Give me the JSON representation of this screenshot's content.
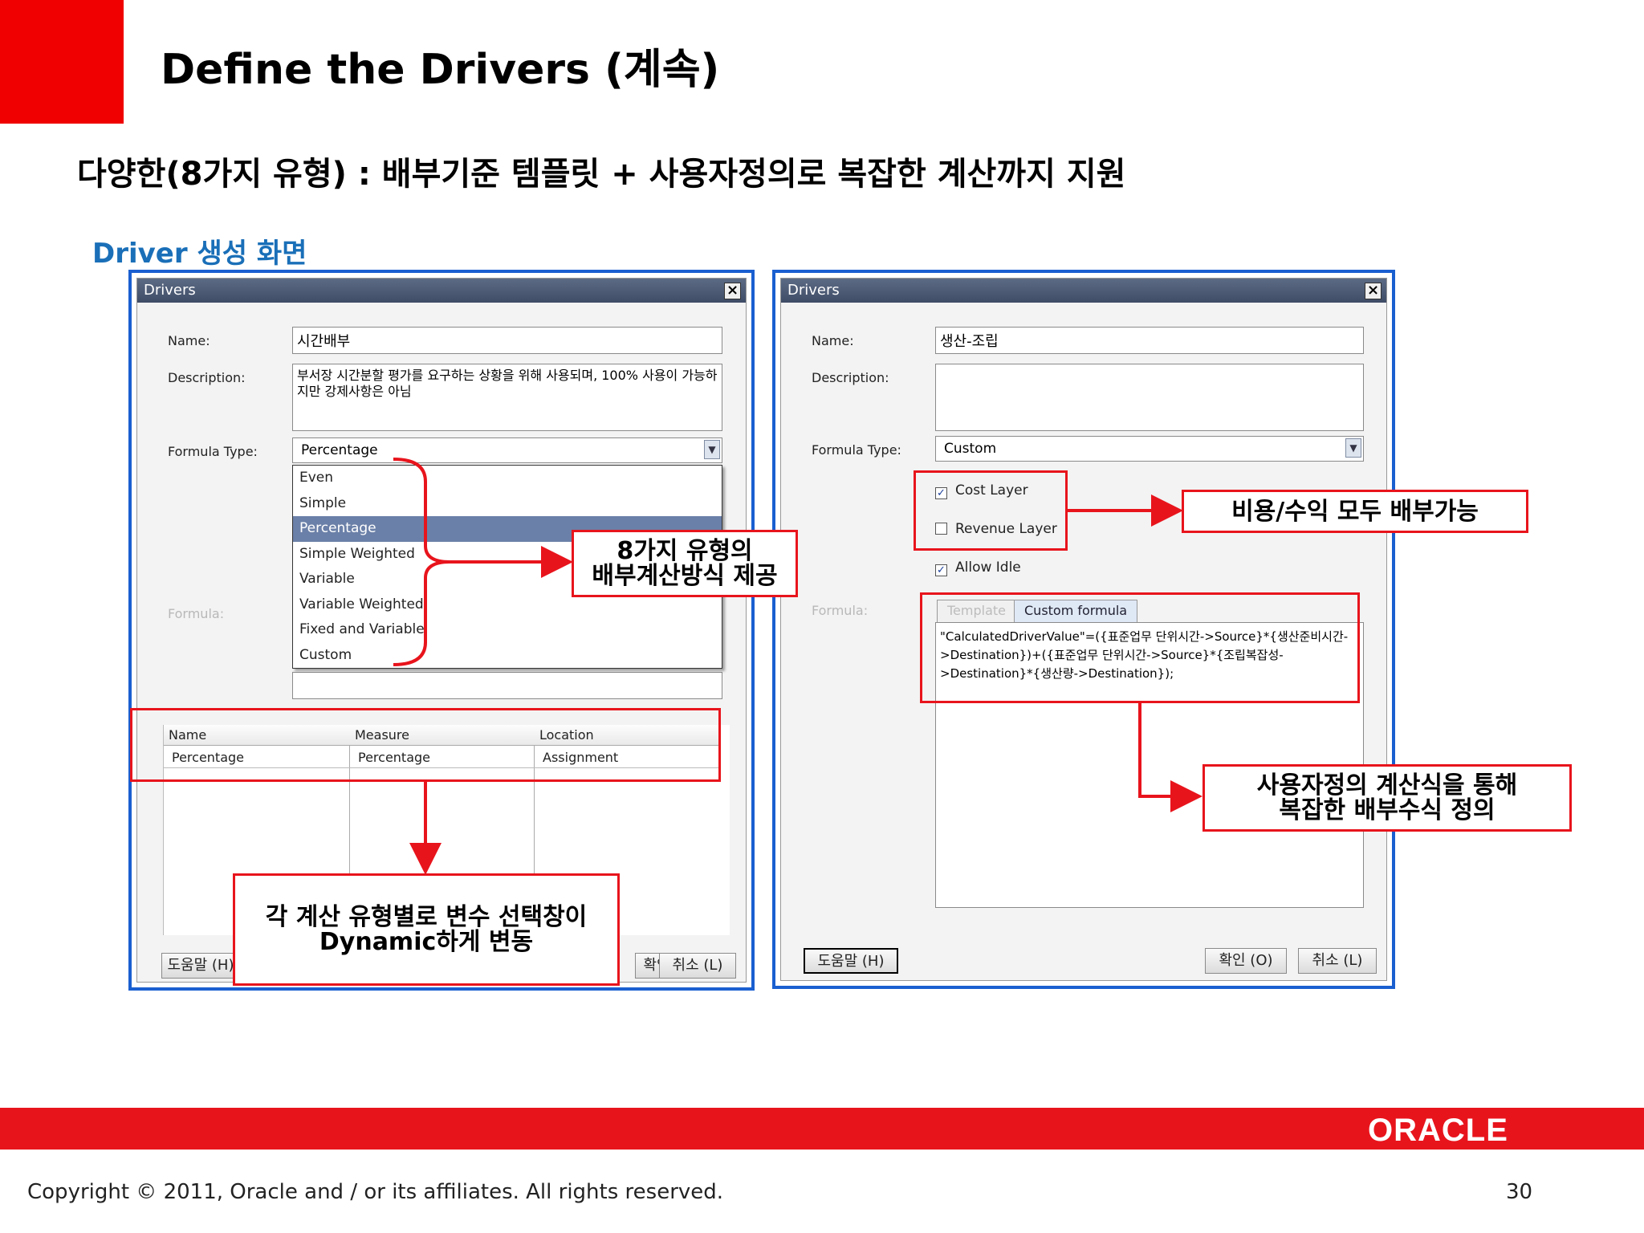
{
  "slide": {
    "title": "Define the Drivers (계속)",
    "subtitle": "다양한(8가지 유형) : 배부기준 템플릿  + 사용자정의로 복잡한 계산까지 지원",
    "section_label": "Driver 생성 화면",
    "accent_color": "#e8141c",
    "label_color": "#1a6fb8"
  },
  "left_dialog": {
    "title": "Drivers",
    "close_icon": "×",
    "name_label": "Name:",
    "name_value": "시간배부",
    "description_label": "Description:",
    "description_value": "부서장 시간분할 평가를 요구하는 상황을 위해 사용되며, 100% 사용이 가능하지만 강제사항은 아님",
    "formula_type_label": "Formula Type:",
    "formula_type_value": "Percentage",
    "formula_label": "Formula:",
    "dropdown_options": [
      "Even",
      "Simple",
      "Percentage",
      "Simple Weighted",
      "Variable",
      "Variable Weighted",
      "Fixed and Variable",
      "Custom"
    ],
    "dropdown_selected": "Percentage",
    "grid_headers": [
      "Name",
      "Measure",
      "Location"
    ],
    "grid_row": [
      "Percentage",
      "Percentage",
      "Assignment"
    ],
    "help_button": "도움말 (H)",
    "ok_button": "확인 (O)",
    "cancel_button": "취소 (L)"
  },
  "right_dialog": {
    "title": "Drivers",
    "close_icon": "×",
    "name_label": "Name:",
    "name_value": "생산-조립",
    "description_label": "Description:",
    "description_value": "",
    "formula_type_label": "Formula Type:",
    "formula_type_value": "Custom",
    "cost_layer_label": "Cost Layer",
    "cost_layer_checked": true,
    "revenue_layer_label": "Revenue Layer",
    "revenue_layer_checked": false,
    "allow_idle_label": "Allow Idle",
    "allow_idle_checked": true,
    "formula_label": "Formula:",
    "tab_template": "Template",
    "tab_custom": "Custom formula",
    "formula_text": "\"CalculatedDriverValue\"=({표준업무 단위시간->Source}*{생산준비시간->Destination})+({표준업무 단위시간->Source}*{조립복잡성->Destination}*{생산량->Destination});",
    "help_button": "도움말 (H)",
    "ok_button": "확인 (O)",
    "cancel_button": "취소 (L)"
  },
  "callouts": {
    "types": [
      "8가지 유형의",
      "배부계산방식 제공"
    ],
    "layers": [
      "비용/수익 모두 배부가능"
    ],
    "custom": [
      "사용자정의 계산식을 통해",
      "복잡한 배부수식 정의"
    ],
    "dynamic": [
      "각 계산 유형별로 변수 선택창이",
      "Dynamic하게 변동"
    ]
  },
  "footer": {
    "logo": "ORACLE",
    "copyright": "Copyright © 2011, Oracle and / or its affiliates. All rights reserved.",
    "page_number": "30"
  }
}
